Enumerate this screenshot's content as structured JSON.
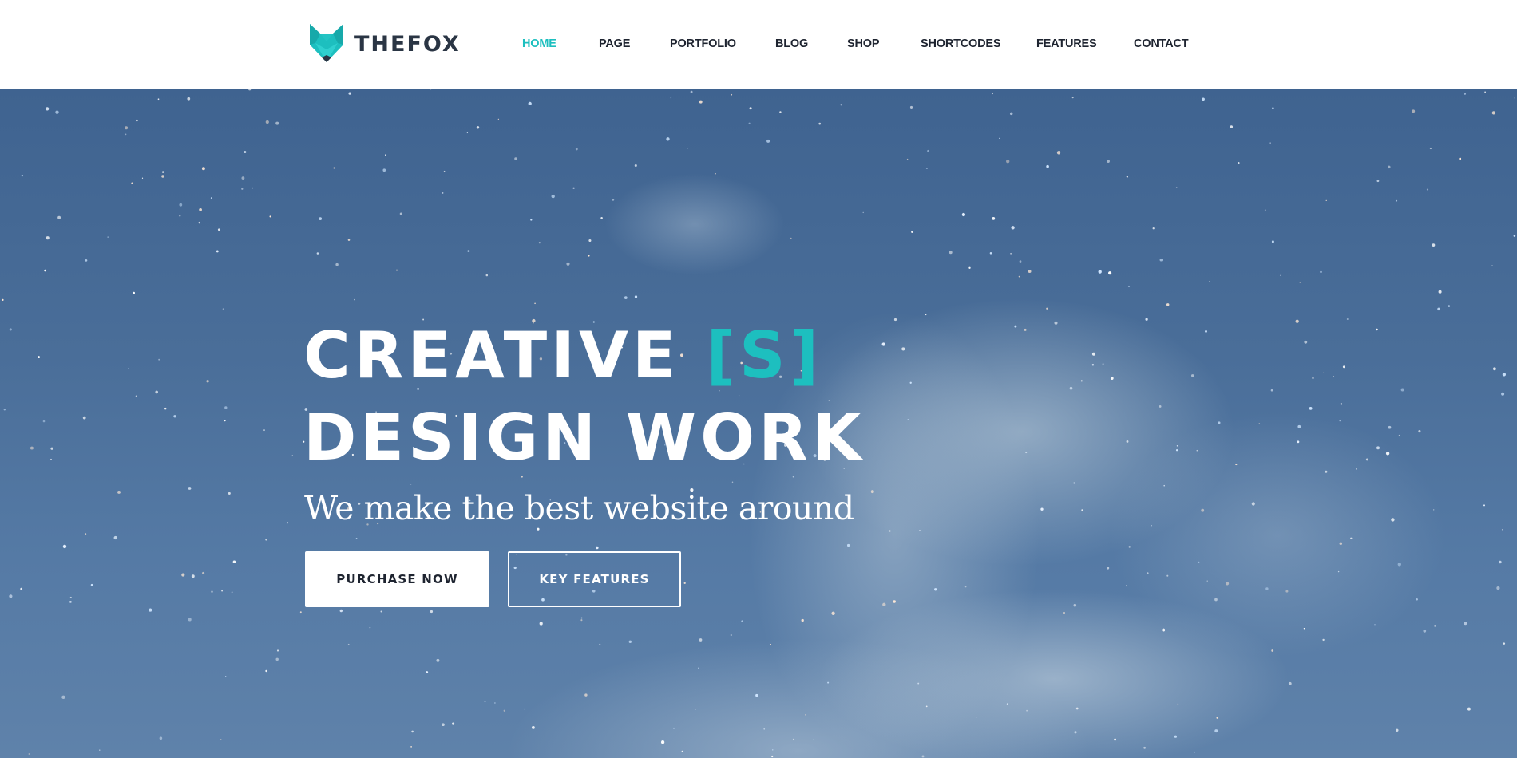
{
  "brand": {
    "name": "THEFOX",
    "logo_icon": "fox-head-icon",
    "accent_color": "#1dbfbf",
    "text_color": "#2a3544"
  },
  "nav": {
    "items": [
      {
        "label": "HOME",
        "active": true
      },
      {
        "label": "PAGE",
        "active": false
      },
      {
        "label": "PORTFOLIO",
        "active": false
      },
      {
        "label": "BLOG",
        "active": false
      },
      {
        "label": "SHOP",
        "active": false
      },
      {
        "label": "SHORTCODES",
        "active": false
      },
      {
        "label": "FEATURES",
        "active": false
      },
      {
        "label": "CONTACT",
        "active": false
      }
    ]
  },
  "hero": {
    "title_line1": "CREATIVE",
    "title_accent": "[S]",
    "title_line2": "DESIGN WORK",
    "subtitle": "We make the best website around",
    "primary_button": "PURCHASE NOW",
    "secondary_button": "KEY FEATURES"
  }
}
